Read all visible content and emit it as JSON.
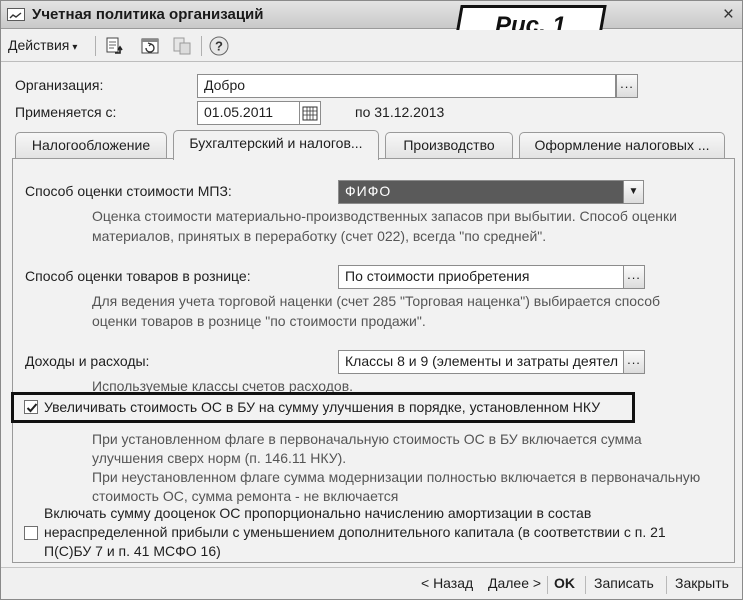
{
  "window": {
    "title": "Учетная политика организаций",
    "close_icon": "×",
    "figure_label": "Рис. 1"
  },
  "toolbar": {
    "actions_label": "Действия",
    "actions_caret": "▾",
    "help_icon": "?"
  },
  "form": {
    "organization_label": "Организация:",
    "organization_value": "Добро",
    "organization_button": "...",
    "applies_label": "Применяется с:",
    "applies_date": "01.05.2011",
    "applies_until": "по 31.12.2013"
  },
  "tabs": [
    {
      "label": "Налогообложение",
      "active": false
    },
    {
      "label": "Бухгалтерский и налогов...",
      "active": true
    },
    {
      "label": "Производство",
      "active": false
    },
    {
      "label": "Оформление налоговых ...",
      "active": false
    }
  ],
  "accounting": {
    "mpz_label": "Способ оценки стоимости МПЗ:",
    "mpz_value": "ФИФО",
    "mpz_arrow": "▼",
    "mpz_desc_line1": "Оценка стоимости материально-производственных запасов при выбытии. Способ оценки",
    "mpz_desc_line2": "материалов, принятых в переработку (счет 022), всегда \"по средней\".",
    "retail_label": "Способ оценки товаров в рознице:",
    "retail_value": "По стоимости приобретения",
    "retail_button": "...",
    "retail_desc_line1": "Для ведения учета торговой наценки (счет 285 \"Торговая наценка\") выбирается способ",
    "retail_desc_line2": "оценки товаров в рознице \"по стоимости продажи\".",
    "income_label": "Доходы и расходы:",
    "income_value": "Классы 8 и 9 (элементы и затраты деятел",
    "income_button": "...",
    "income_desc": "Используемые классы счетов расходов.",
    "improve_checkbox_label": "Увеличивать стоимость ОС в БУ на сумму улучшения в порядке, установленном НКУ",
    "improve_checked": true,
    "improve_desc_line1": "При установленном флаге в первоначальную стоимость ОС в БУ включается сумма",
    "improve_desc_line2": "улучшения сверх норм (п. 146.11 НКУ).",
    "improve_desc_line3": "При неустановленном флаге сумма модернизации полностью включается в первоначальную",
    "improve_desc_line4": "стоимость ОС, сумма ремонта - не включается",
    "revaluation_label_line1": "Включать сумму дооценок ОС пропорционально начислению амортизации в состав",
    "revaluation_label_line2": "нераспределенной прибыли с уменьшением дополнительного капитала (в соответствии с п. 21",
    "revaluation_label_line3": "П(С)БУ 7 и п. 41 МСФО 16)",
    "revaluation_checked": false
  },
  "footer": {
    "back_label": "< Назад",
    "next_label": "Далее >",
    "ok_label": "OK",
    "save_label": "Записать",
    "close_label": "Закрыть"
  }
}
